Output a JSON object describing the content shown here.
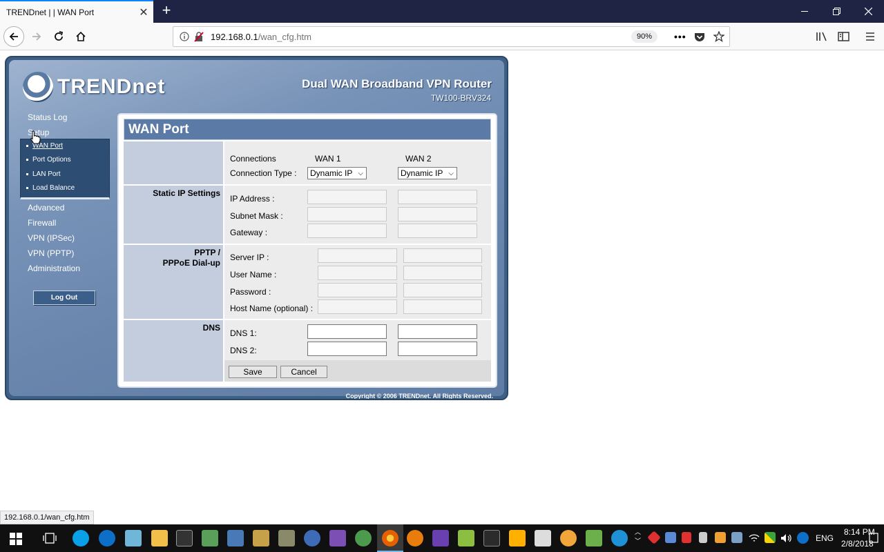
{
  "browser": {
    "tab_title": "TRENDnet | | WAN Port",
    "url_host": "192.168.0.1",
    "url_path": "/wan_cfg.htm",
    "zoom": "90%",
    "status_url": "192.168.0.1/wan_cfg.htm"
  },
  "router": {
    "brand": "TRENDnet",
    "product_name": "Dual WAN Broadband VPN Router",
    "model": "TW100-BRV324",
    "copyright": "Copyright © 2006 TRENDnet. All Rights Reserved.",
    "menu": {
      "status_log": "Status Log",
      "setup": "Setup",
      "advanced": "Advanced",
      "firewall": "Firewall",
      "vpn_ipsec": "VPN (IPSec)",
      "vpn_pptp": "VPN (PPTP)",
      "administration": "Administration"
    },
    "submenu": [
      "WAN Port",
      "Port Options",
      "LAN Port",
      "Load Balance"
    ],
    "logout": "Log Out"
  },
  "panel": {
    "title": "WAN Port",
    "connections_label": "Connections",
    "wan1": "WAN 1",
    "wan2": "WAN 2",
    "connection_type_label": "Connection Type :",
    "wan1_type": "Dynamic IP",
    "wan2_type": "Dynamic IP",
    "static_section": "Static IP Settings",
    "ip_address": "IP Address :",
    "subnet_mask": "Subnet Mask :",
    "gateway": "Gateway :",
    "pptp_section_line1": "PPTP /",
    "pptp_section_line2": "PPPoE Dial-up",
    "server_ip": "Server IP :",
    "user_name": "User Name :",
    "password": "Password :",
    "host_name": "Host Name (optional) :",
    "dns_section": "DNS",
    "dns1": "DNS 1:",
    "dns2": "DNS 2:",
    "save": "Save",
    "cancel": "Cancel"
  },
  "taskbar": {
    "time": "8:14 PM",
    "date": "2/8/2018",
    "lang": "ENG"
  }
}
